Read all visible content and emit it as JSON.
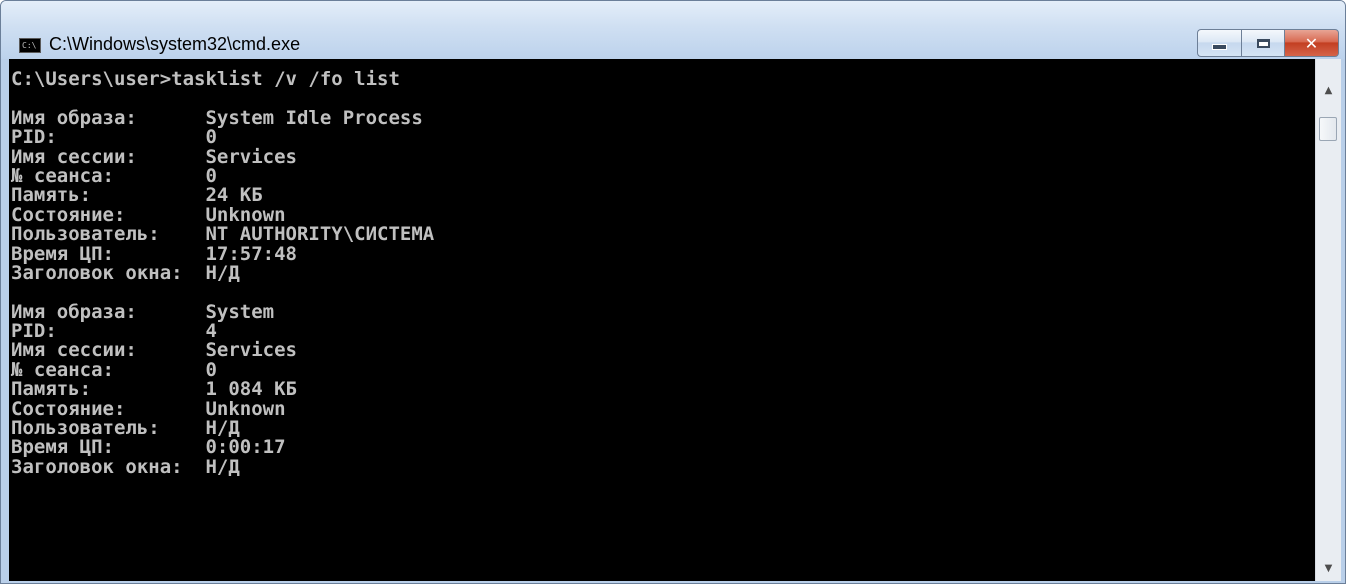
{
  "window": {
    "title": "C:\\Windows\\system32\\cmd.exe",
    "icon_text": "C:\\"
  },
  "console": {
    "lines": [
      "C:\\Users\\user>tasklist /v /fo list",
      "",
      "Имя образа:      System Idle Process",
      "PID:             0",
      "Имя сессии:      Services",
      "№ сеанса:        0",
      "Память:          24 КБ",
      "Состояние:       Unknown",
      "Пользователь:    NT AUTHORITY\\СИСТЕМА",
      "Время ЦП:        17:57:48",
      "Заголовок окна:  Н/Д",
      "",
      "Имя образа:      System",
      "PID:             4",
      "Имя сессии:      Services",
      "№ сеанса:        0",
      "Память:          1 084 КБ",
      "Состояние:       Unknown",
      "Пользователь:    Н/Д",
      "Время ЦП:        0:00:17",
      "Заголовок окна:  Н/Д"
    ]
  },
  "colors": {
    "console_bg": "#000000",
    "console_fg": "#c0c0c0",
    "close_button": "#c94429"
  },
  "icons": {
    "app": "console-app-icon",
    "minimize": "minimize-icon",
    "maximize": "maximize-icon",
    "close": "close-icon",
    "scroll_up": "scroll-up-arrow-icon",
    "scroll_down": "scroll-down-arrow-icon"
  },
  "glyphs": {
    "close": "✕",
    "up": "▲",
    "down": "▼"
  }
}
